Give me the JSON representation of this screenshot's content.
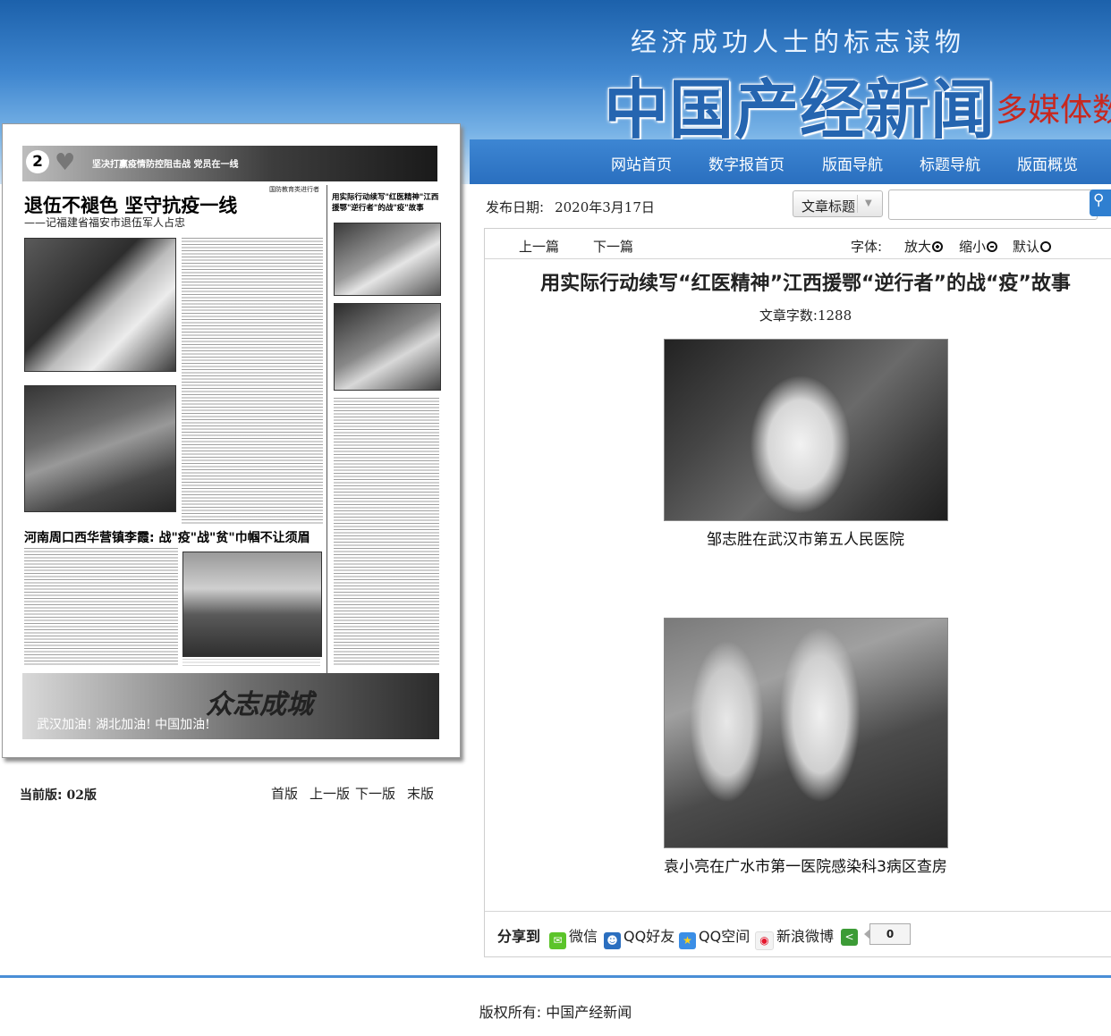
{
  "header": {
    "tagline": "经济成功人士的标志读物",
    "logo": "中国产经新闻",
    "sublogo": "多媒体数",
    "nav": [
      "网站首页",
      "数字报首页",
      "版面导航",
      "标题导航",
      "版面概览"
    ]
  },
  "paper": {
    "page_number": "2",
    "banner_text": "坚决打赢疫情防控阻击战 党员在一线",
    "headline": "退伍不褪色 坚守抗疫一线",
    "subheadline": "——记福建省福安市退伍军人占忠",
    "right_headline": "用实际行动续写\"红医精神\"江西援鄂\"逆行者\"的战\"疫\"故事",
    "small_tag": "国防教育类进行者",
    "headline2": "河南周口西华营镇李霞: 战\"疫\"战\"贫\"巾帼不让须眉",
    "footer_slogan": "众志成城",
    "footer_text": "武汉加油! 湖北加油! 中国加油!"
  },
  "page_nav": {
    "current_label": "当前版:",
    "current_value": "02版",
    "first": "首版",
    "prev": "上一版",
    "next": "下一版",
    "last": "末版"
  },
  "article": {
    "date_label": "发布日期:",
    "date": "2020年3月17日",
    "search_select": "文章标题",
    "search_placeholder": "",
    "prev_article": "上一篇",
    "next_article": "下一篇",
    "font_label": "字体:",
    "zoom_in": "放大",
    "zoom_out": "缩小",
    "default": "默认",
    "title": "用实际行动续写“红医精神”江西援鄂“逆行者”的战“疫”故事",
    "wordcount_label": "文章字数:",
    "wordcount": "1288",
    "photo1_caption": "邹志胜在武汉市第五人民医院",
    "photo2_caption": "袁小亮在广水市第一医院感染科3病区查房"
  },
  "share": {
    "label": "分享到",
    "items": [
      "微信",
      "QQ好友",
      "QQ空间",
      "新浪微博"
    ],
    "count": "0"
  },
  "footer": {
    "copyright": "版权所有: 中国产经新闻"
  },
  "colors": {
    "nav_blue": "#2f78c8",
    "link_accent": "#2f7fd0",
    "wechat": "#5cc42a",
    "weibo": "#e6162d"
  }
}
